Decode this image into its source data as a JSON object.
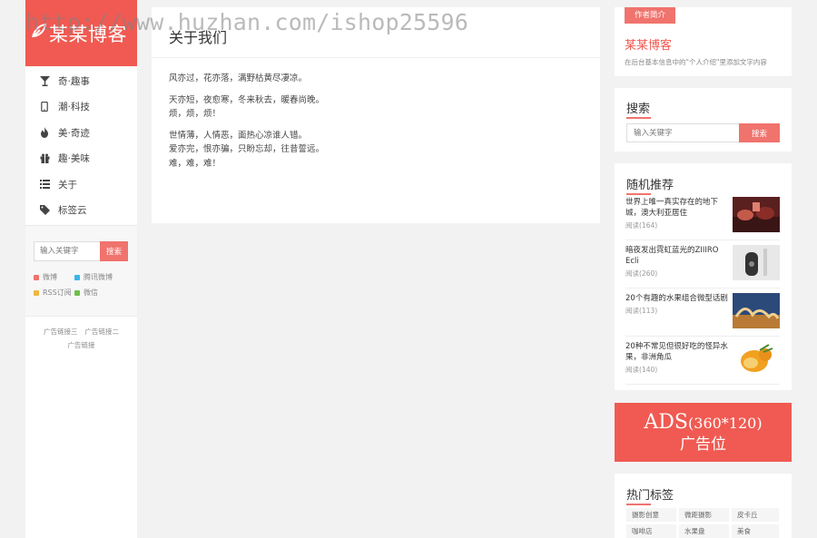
{
  "watermark": "http://www.huzhan.com/ishop25596",
  "logo": {
    "text": "某某博客"
  },
  "nav": {
    "items": [
      {
        "label": "奇·趣事",
        "icon": "cocktail-icon"
      },
      {
        "label": "潮·科技",
        "icon": "mobile-icon"
      },
      {
        "label": "美·奇迹",
        "icon": "fire-icon"
      },
      {
        "label": "趣·美味",
        "icon": "gift-icon"
      },
      {
        "label": "关于",
        "icon": "list-icon"
      },
      {
        "label": "标签云",
        "icon": "tag-icon"
      }
    ]
  },
  "left_search": {
    "placeholder": "输入关键字",
    "button": "搜索"
  },
  "social": [
    {
      "label": "微博",
      "color": "#f0736d"
    },
    {
      "label": "腾讯微博",
      "color": "#3ab5e8"
    },
    {
      "label": "RSS订阅",
      "color": "#f2b640"
    },
    {
      "label": "微信",
      "color": "#6cc04a"
    }
  ],
  "left_links": {
    "link1": "广告链接三",
    "link2": "广告链接二",
    "link3": "广告链接"
  },
  "main": {
    "title": "关于我们",
    "paragraphs": {
      "p1": "风亦过，花亦落，满野枯黄尽凄凉。",
      "p2a": "天亦短，夜愈寒，冬来秋去，暖春尚晚。",
      "p2b": "烦，烦，烦！",
      "p3a": "世情薄，人情恶，面热心凉谁人错。",
      "p3b": "爱亦完，恨亦骗，只盼忘却，往昔誓远。",
      "p3c": "难，难，难！"
    }
  },
  "author": {
    "tag": "作者简介",
    "name": "某某博客",
    "desc": "在后台基本信息中的\"个人介绍\"里添加文字内容"
  },
  "search": {
    "title": "搜索",
    "placeholder": "输入关键字",
    "button": "搜索"
  },
  "random": {
    "title": "随机推荐",
    "items": [
      {
        "title": "世界上唯一真实存在的地下城，澳大利亚居住",
        "count": "阅读(164)"
      },
      {
        "title": "暗夜发出霓虹蓝光的ZIIIRO Ecli",
        "count": "阅读(260)"
      },
      {
        "title": "20个有趣的水果组合微型话剧",
        "count": "阅读(113)"
      },
      {
        "title": "20种不常见但很好吃的怪异水果，非洲角瓜",
        "count": "阅读(140)"
      }
    ]
  },
  "ads": {
    "line1": "ADS",
    "line1_small": "(360*120)",
    "line2": "广告位"
  },
  "tags": {
    "title": "热门标签",
    "items": [
      "摄影创意",
      "微距摄影",
      "皮卡丘",
      "咖啡店",
      "水果盘",
      "美食"
    ]
  },
  "colors": {
    "accent": "#f05a52",
    "button": "#f0736d"
  }
}
